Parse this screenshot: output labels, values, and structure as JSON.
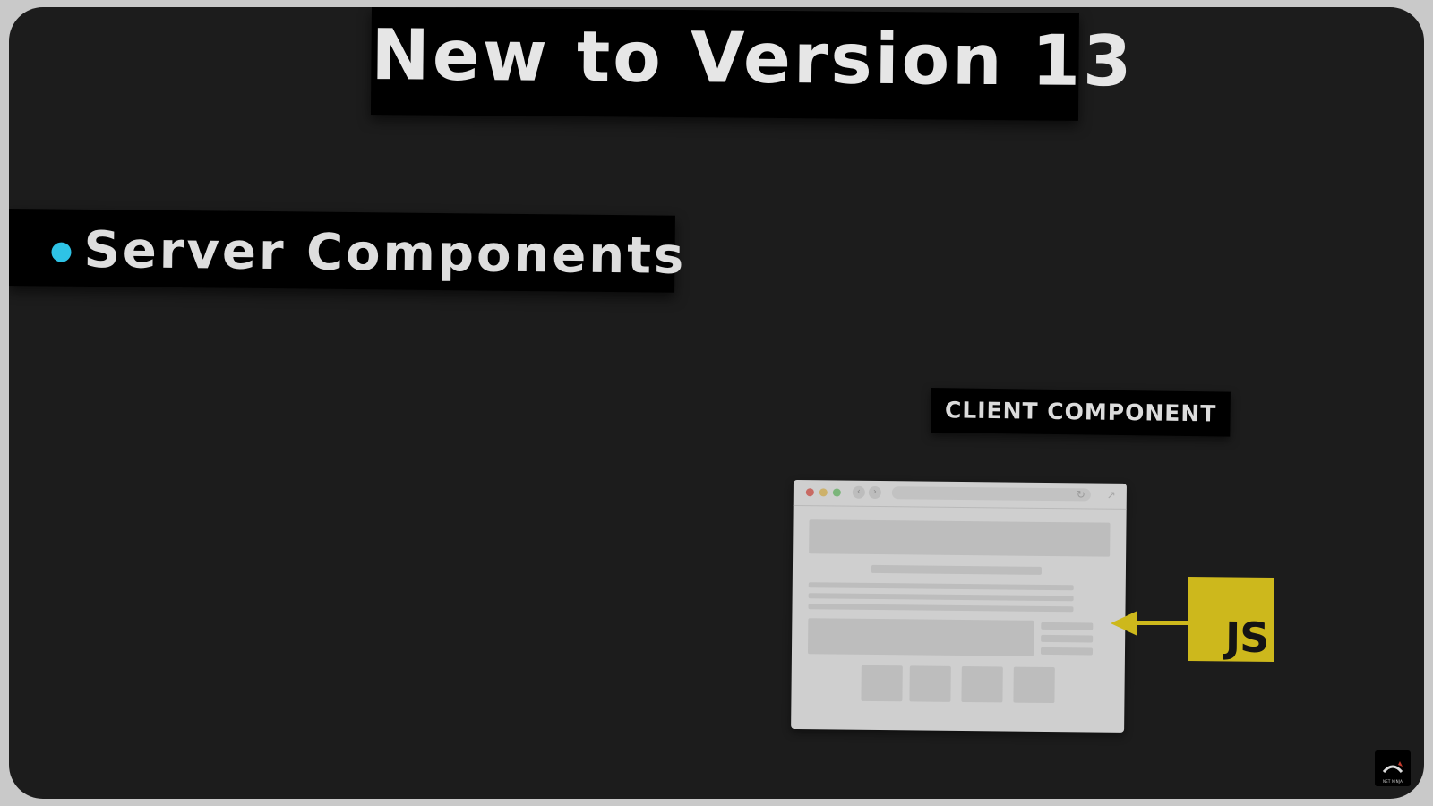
{
  "slide": {
    "title": "New to Version 13",
    "bullet": "Server Components",
    "client_label": "CLIENT COMPONENT",
    "js_badge": "JS",
    "logo_text": "NET NINJA"
  },
  "colors": {
    "bullet_dot": "#2ec3e6",
    "js_badge": "#cdb81c",
    "background": "#1c1c1c"
  },
  "icons": {
    "browser": "browser-window-icon",
    "arrow": "arrow-left-icon",
    "logo": "net-ninja-logo-icon"
  }
}
